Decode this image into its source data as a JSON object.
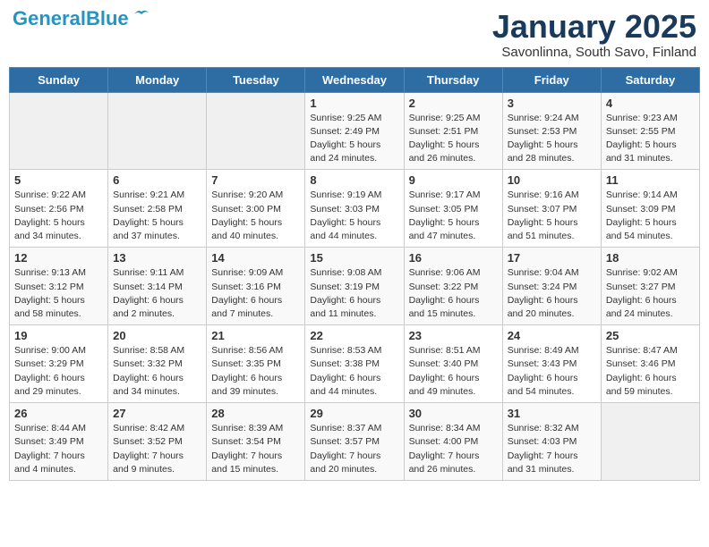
{
  "header": {
    "logo_line1": "General",
    "logo_line2": "Blue",
    "month": "January 2025",
    "location": "Savonlinna, South Savo, Finland"
  },
  "days_of_week": [
    "Sunday",
    "Monday",
    "Tuesday",
    "Wednesday",
    "Thursday",
    "Friday",
    "Saturday"
  ],
  "weeks": [
    [
      {
        "day": "",
        "info": ""
      },
      {
        "day": "",
        "info": ""
      },
      {
        "day": "",
        "info": ""
      },
      {
        "day": "1",
        "info": "Sunrise: 9:25 AM\nSunset: 2:49 PM\nDaylight: 5 hours\nand 24 minutes."
      },
      {
        "day": "2",
        "info": "Sunrise: 9:25 AM\nSunset: 2:51 PM\nDaylight: 5 hours\nand 26 minutes."
      },
      {
        "day": "3",
        "info": "Sunrise: 9:24 AM\nSunset: 2:53 PM\nDaylight: 5 hours\nand 28 minutes."
      },
      {
        "day": "4",
        "info": "Sunrise: 9:23 AM\nSunset: 2:55 PM\nDaylight: 5 hours\nand 31 minutes."
      }
    ],
    [
      {
        "day": "5",
        "info": "Sunrise: 9:22 AM\nSunset: 2:56 PM\nDaylight: 5 hours\nand 34 minutes."
      },
      {
        "day": "6",
        "info": "Sunrise: 9:21 AM\nSunset: 2:58 PM\nDaylight: 5 hours\nand 37 minutes."
      },
      {
        "day": "7",
        "info": "Sunrise: 9:20 AM\nSunset: 3:00 PM\nDaylight: 5 hours\nand 40 minutes."
      },
      {
        "day": "8",
        "info": "Sunrise: 9:19 AM\nSunset: 3:03 PM\nDaylight: 5 hours\nand 44 minutes."
      },
      {
        "day": "9",
        "info": "Sunrise: 9:17 AM\nSunset: 3:05 PM\nDaylight: 5 hours\nand 47 minutes."
      },
      {
        "day": "10",
        "info": "Sunrise: 9:16 AM\nSunset: 3:07 PM\nDaylight: 5 hours\nand 51 minutes."
      },
      {
        "day": "11",
        "info": "Sunrise: 9:14 AM\nSunset: 3:09 PM\nDaylight: 5 hours\nand 54 minutes."
      }
    ],
    [
      {
        "day": "12",
        "info": "Sunrise: 9:13 AM\nSunset: 3:12 PM\nDaylight: 5 hours\nand 58 minutes."
      },
      {
        "day": "13",
        "info": "Sunrise: 9:11 AM\nSunset: 3:14 PM\nDaylight: 6 hours\nand 2 minutes."
      },
      {
        "day": "14",
        "info": "Sunrise: 9:09 AM\nSunset: 3:16 PM\nDaylight: 6 hours\nand 7 minutes."
      },
      {
        "day": "15",
        "info": "Sunrise: 9:08 AM\nSunset: 3:19 PM\nDaylight: 6 hours\nand 11 minutes."
      },
      {
        "day": "16",
        "info": "Sunrise: 9:06 AM\nSunset: 3:22 PM\nDaylight: 6 hours\nand 15 minutes."
      },
      {
        "day": "17",
        "info": "Sunrise: 9:04 AM\nSunset: 3:24 PM\nDaylight: 6 hours\nand 20 minutes."
      },
      {
        "day": "18",
        "info": "Sunrise: 9:02 AM\nSunset: 3:27 PM\nDaylight: 6 hours\nand 24 minutes."
      }
    ],
    [
      {
        "day": "19",
        "info": "Sunrise: 9:00 AM\nSunset: 3:29 PM\nDaylight: 6 hours\nand 29 minutes."
      },
      {
        "day": "20",
        "info": "Sunrise: 8:58 AM\nSunset: 3:32 PM\nDaylight: 6 hours\nand 34 minutes."
      },
      {
        "day": "21",
        "info": "Sunrise: 8:56 AM\nSunset: 3:35 PM\nDaylight: 6 hours\nand 39 minutes."
      },
      {
        "day": "22",
        "info": "Sunrise: 8:53 AM\nSunset: 3:38 PM\nDaylight: 6 hours\nand 44 minutes."
      },
      {
        "day": "23",
        "info": "Sunrise: 8:51 AM\nSunset: 3:40 PM\nDaylight: 6 hours\nand 49 minutes."
      },
      {
        "day": "24",
        "info": "Sunrise: 8:49 AM\nSunset: 3:43 PM\nDaylight: 6 hours\nand 54 minutes."
      },
      {
        "day": "25",
        "info": "Sunrise: 8:47 AM\nSunset: 3:46 PM\nDaylight: 6 hours\nand 59 minutes."
      }
    ],
    [
      {
        "day": "26",
        "info": "Sunrise: 8:44 AM\nSunset: 3:49 PM\nDaylight: 7 hours\nand 4 minutes."
      },
      {
        "day": "27",
        "info": "Sunrise: 8:42 AM\nSunset: 3:52 PM\nDaylight: 7 hours\nand 9 minutes."
      },
      {
        "day": "28",
        "info": "Sunrise: 8:39 AM\nSunset: 3:54 PM\nDaylight: 7 hours\nand 15 minutes."
      },
      {
        "day": "29",
        "info": "Sunrise: 8:37 AM\nSunset: 3:57 PM\nDaylight: 7 hours\nand 20 minutes."
      },
      {
        "day": "30",
        "info": "Sunrise: 8:34 AM\nSunset: 4:00 PM\nDaylight: 7 hours\nand 26 minutes."
      },
      {
        "day": "31",
        "info": "Sunrise: 8:32 AM\nSunset: 4:03 PM\nDaylight: 7 hours\nand 31 minutes."
      },
      {
        "day": "",
        "info": ""
      }
    ]
  ]
}
